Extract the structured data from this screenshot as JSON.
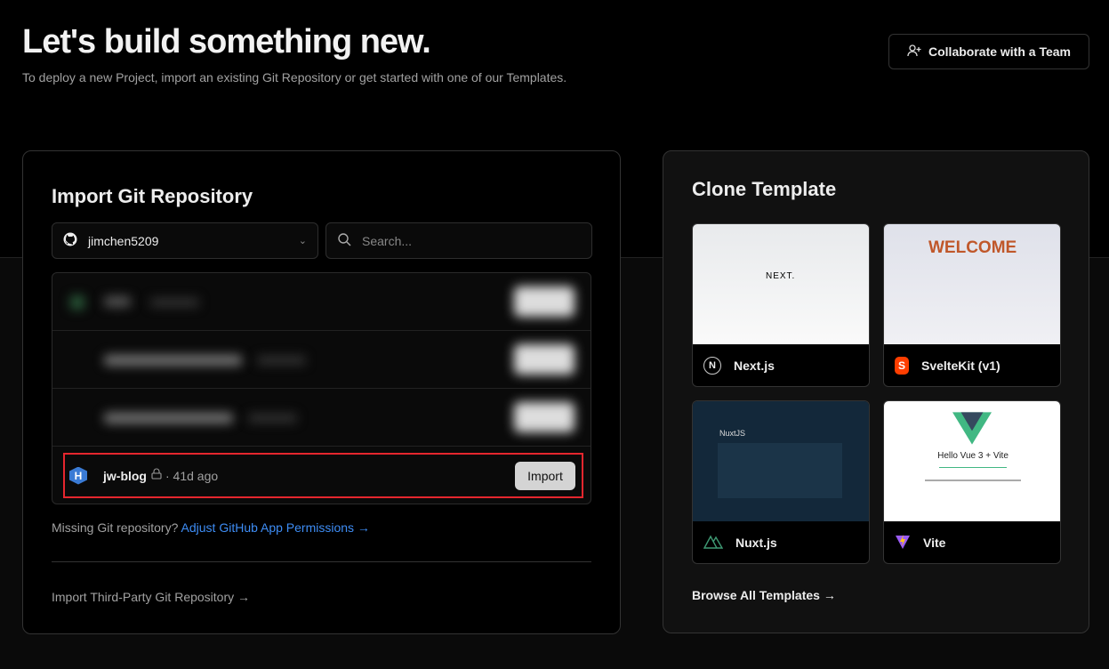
{
  "header": {
    "title": "Let's build something new.",
    "subtitle": "To deploy a new Project, import an existing Git Repository or get started with one of our Templates.",
    "collab_button": "Collaborate with a Team"
  },
  "import": {
    "title": "Import Git Repository",
    "account": "jimchen5209",
    "search_placeholder": "Search...",
    "repo": {
      "name": "jw-blog",
      "avatar": "H",
      "age": "· 41d ago",
      "button": "Import"
    },
    "missing_text": "Missing Git repository?",
    "missing_link": "Adjust GitHub App Permissions →",
    "third_party": "Import Third-Party Git Repository →"
  },
  "clone": {
    "title": "Clone Template",
    "templates": [
      {
        "name": "Next.js",
        "thumb_text": "NEXT."
      },
      {
        "name": "SvelteKit (v1)",
        "thumb_text": "WELCOME"
      },
      {
        "name": "Nuxt.js",
        "thumb_text": "NuxtJS"
      },
      {
        "name": "Vite",
        "thumb_text": "Hello Vue 3 + Vite"
      }
    ],
    "browse": "Browse All Templates →"
  },
  "colors": {
    "accent_link": "#3e8df5",
    "highlight": "#e5262e"
  }
}
